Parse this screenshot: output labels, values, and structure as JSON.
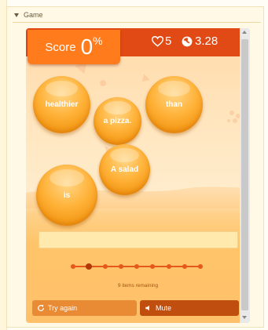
{
  "section": {
    "title": "Game"
  },
  "hud": {
    "score_label": "Score",
    "score_value": "0",
    "score_unit": "%",
    "lives": "5",
    "time": "3.28"
  },
  "words": [
    "healthier",
    "a pizza.",
    "than",
    "A salad",
    "is"
  ],
  "progress": {
    "total_items": 9,
    "current_index": 1,
    "remaining_text": "9 items remaining"
  },
  "buttons": {
    "try_again": "Try again",
    "mute": "Mute"
  },
  "colors": {
    "top_bar": "#e24a15",
    "score_box": "#ff7b1c",
    "bubble": "#f49a18",
    "progress": "#e55a1a",
    "try_again": "#e98a34",
    "mute": "#c04e0f"
  },
  "icons": {
    "lives": "heart-icon",
    "timer": "clock-icon",
    "try_again": "refresh-icon",
    "mute": "speaker-icon"
  }
}
